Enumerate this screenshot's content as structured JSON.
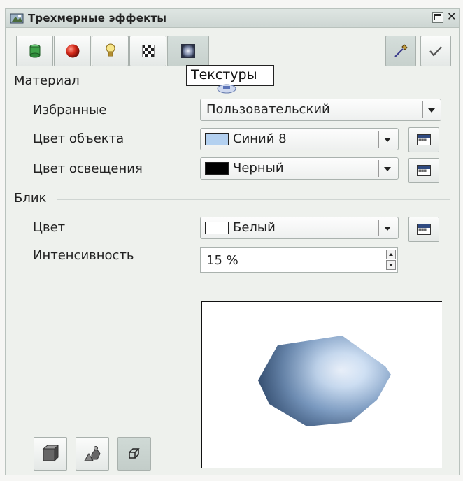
{
  "window": {
    "title": "Трехмерные эффекты",
    "title_icon": "3d-effects-icon",
    "maximize_icon": "maximize-icon",
    "close_icon": "close-icon"
  },
  "toolbar": {
    "tabs": [
      {
        "icon": "geometry-icon",
        "active": false
      },
      {
        "icon": "shading-icon",
        "active": false
      },
      {
        "icon": "lightbulb-icon",
        "active": false
      },
      {
        "icon": "textures-icon",
        "active": false
      },
      {
        "icon": "material-icon",
        "active": true
      }
    ],
    "right_buttons": [
      {
        "icon": "pipette-icon",
        "active": true
      },
      {
        "icon": "assign-checkmark-icon",
        "active": false
      }
    ],
    "tooltip": "Текстуры"
  },
  "material": {
    "section_title": "Материал",
    "favorites_label": "Избранные",
    "favorites_value": "Пользовательский",
    "object_color_label": "Цвет объекта",
    "object_color_value": "Синий 8",
    "object_color_hex": "#b3d0f0",
    "illumination_label": "Цвет освещения",
    "illumination_value": "Черный",
    "illumination_hex": "#000000"
  },
  "specular": {
    "section_title": "Блик",
    "color_label": "Цвет",
    "color_value": "Белый",
    "color_hex": "#ffffff",
    "intensity_label": "Интенсивность",
    "intensity_value": "15 %"
  },
  "bottom_buttons": [
    {
      "icon": "convert-3d-icon",
      "active": false
    },
    {
      "icon": "lathe-object-icon",
      "active": false
    },
    {
      "icon": "perspective-icon",
      "active": true
    }
  ]
}
